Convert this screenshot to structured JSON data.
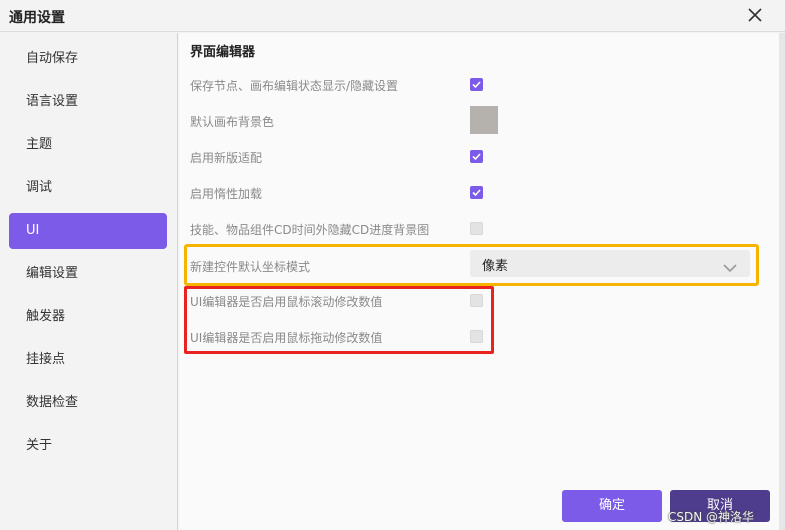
{
  "window": {
    "title": "通用设置"
  },
  "sidebar": {
    "items": [
      {
        "label": "自动保存"
      },
      {
        "label": "语言设置"
      },
      {
        "label": "主题"
      },
      {
        "label": "调试"
      },
      {
        "label": "UI",
        "active": true
      },
      {
        "label": "编辑设置"
      },
      {
        "label": "触发器"
      },
      {
        "label": "挂接点"
      },
      {
        "label": "数据检查"
      },
      {
        "label": "关于"
      }
    ]
  },
  "main": {
    "section_title": "界面编辑器",
    "rows": [
      {
        "label": "保存节点、画布编辑状态显示/隐藏设置",
        "control": "checkbox",
        "checked": true
      },
      {
        "label": "默认画布背景色",
        "control": "color",
        "color": "#b5b2ad"
      },
      {
        "label": "启用新版适配",
        "control": "checkbox",
        "checked": true
      },
      {
        "label": "启用惰性加载",
        "control": "checkbox",
        "checked": true
      },
      {
        "label": "技能、物品组件CD时间外隐藏CD进度背景图",
        "control": "checkbox",
        "checked": false
      },
      {
        "label": "新建控件默认坐标模式",
        "control": "select",
        "value": "像素"
      },
      {
        "label": "UI编辑器是否启用鼠标滚动修改数值",
        "control": "checkbox",
        "checked": false
      },
      {
        "label": "UI编辑器是否启用鼠标拖动修改数值",
        "control": "checkbox",
        "checked": false
      }
    ]
  },
  "footer": {
    "ok_label": "确定",
    "cancel_label": "取消"
  },
  "watermark": "CSDN @神洛华",
  "colors": {
    "accent": "#7b5be8",
    "highlight_yellow": "#f6b400",
    "highlight_red": "#e8231f"
  }
}
